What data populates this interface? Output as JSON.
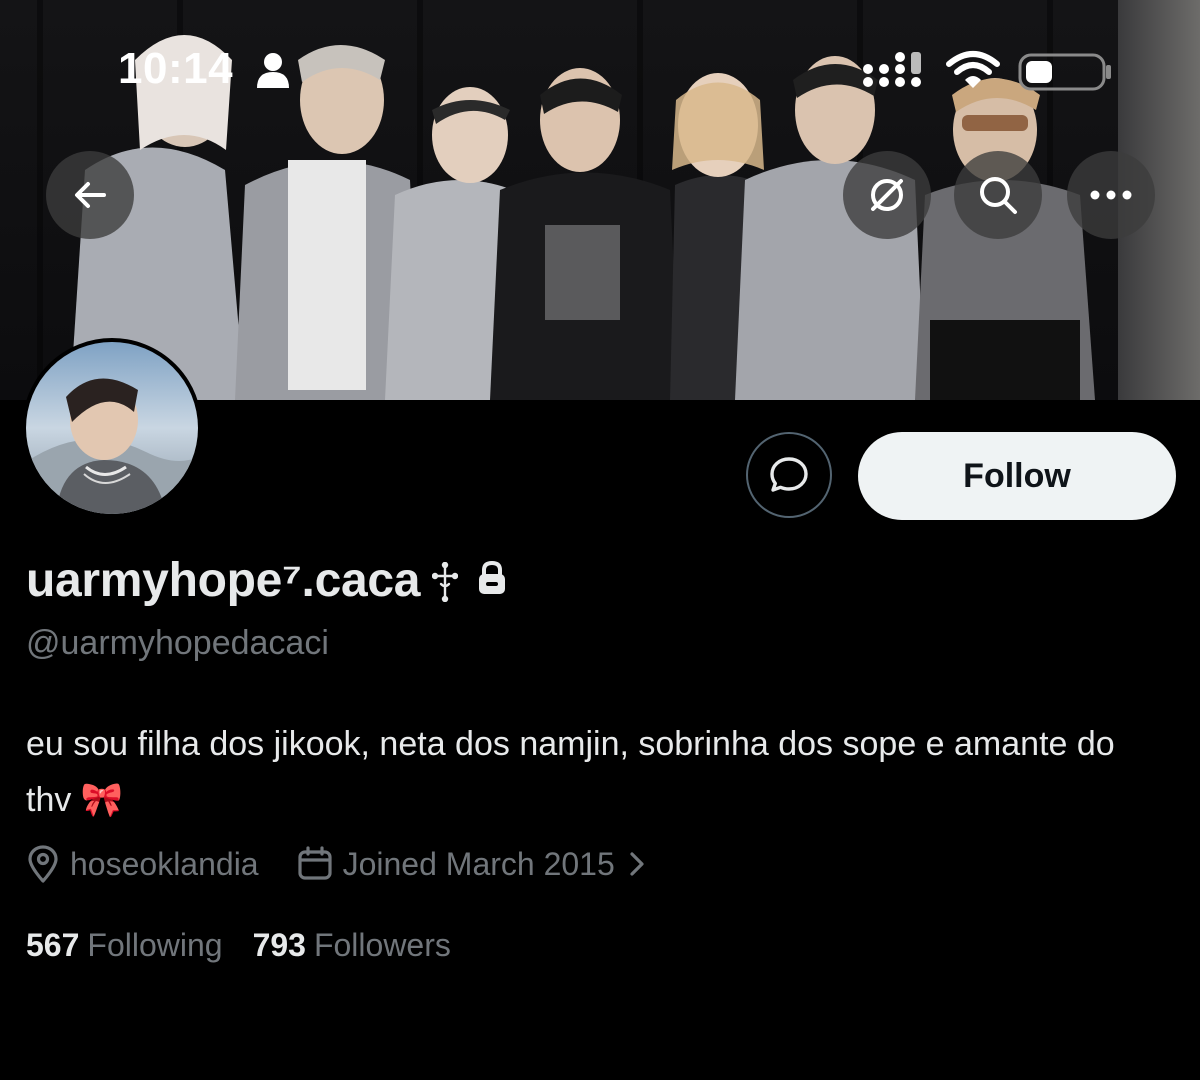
{
  "status_bar": {
    "time": "10:14",
    "icons": [
      "person-icon",
      "cellular-signal-icon",
      "wifi-icon",
      "battery-icon"
    ]
  },
  "header_nav": {
    "icons": [
      "back-arrow-icon",
      "grok-icon",
      "search-icon",
      "more-icon"
    ]
  },
  "profile": {
    "display_name": "uarmyhope⁷.caca",
    "handle": "@uarmyhopedacaci",
    "bio_text": "eu sou filha dos jikook, neta dos namjin, sobrinha dos sope e amante do thv",
    "bio_emoji": "🎀",
    "location": "hoseoklandia",
    "joined": "Joined March 2015",
    "badges": [
      "cross-icon",
      "lock-icon"
    ]
  },
  "actions": {
    "follow_label": "Follow",
    "message_icon": "message-bubble-icon"
  },
  "stats": {
    "following_count": "567",
    "following_label": "Following",
    "followers_count": "793",
    "followers_label": "Followers"
  },
  "colors": {
    "background": "#000000",
    "primary_text": "#e7e9ea",
    "secondary_text": "#71767b",
    "follow_button_bg": "#eff3f4",
    "follow_button_text": "#0f1419",
    "nav_button_bg": "#3c3c3c",
    "border": "#536471"
  }
}
